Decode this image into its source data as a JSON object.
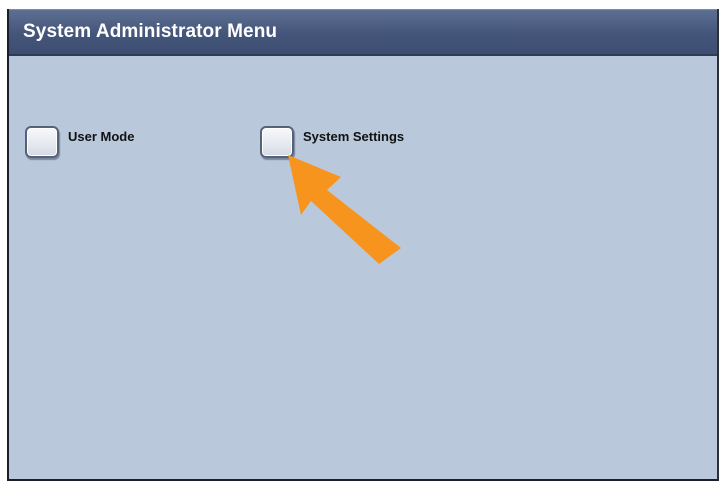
{
  "window": {
    "title": "System Administrator Menu"
  },
  "menu": {
    "items": [
      {
        "label": "User Mode",
        "checked": false
      },
      {
        "label": "System Settings",
        "checked": false
      }
    ]
  },
  "annotation": {
    "arrow_color": "#f7941d",
    "arrow_target": "System Settings"
  },
  "colors": {
    "background": "#b9c9db",
    "title_bar": "#44557a"
  }
}
